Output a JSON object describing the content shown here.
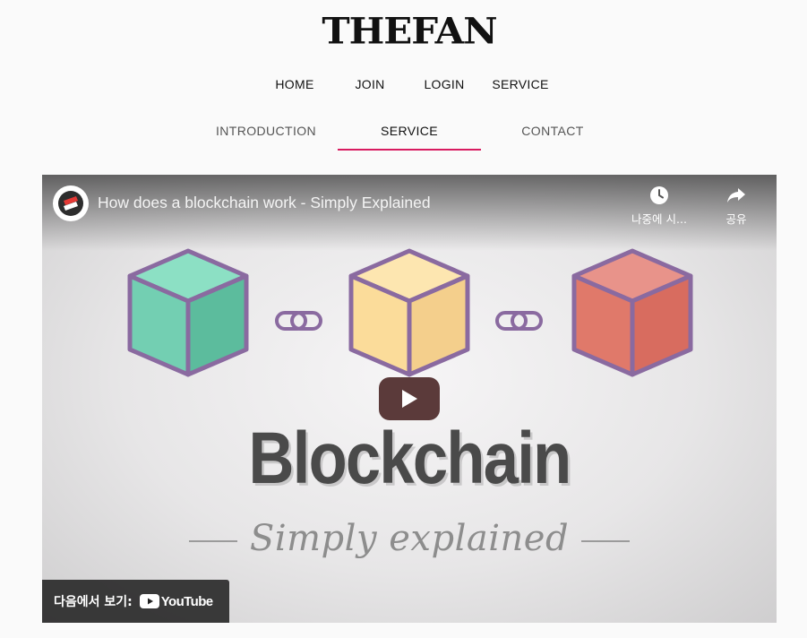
{
  "brand": {
    "logo_text": "THEFAN"
  },
  "nav_top": {
    "items": [
      "HOME",
      "JOIN",
      "LOGIN",
      "SERVICE"
    ]
  },
  "nav_sub": {
    "items": [
      "INTRODUCTION",
      "SERVICE",
      "CONTACT"
    ],
    "active": "SERVICE",
    "accent_color": "#d81b60"
  },
  "video": {
    "title": "How does a blockchain work - Simply Explained",
    "watch_later_label": "나중에 시...",
    "share_label": "공유",
    "thumbnail_title": "Blockchain",
    "thumbnail_subtitle": "Simply explained",
    "watch_on_label": "다음에서 보기:",
    "youtube_wordmark": "YouTube",
    "block_colors": [
      "#73cfb2",
      "#fbdc9a",
      "#e0796a"
    ],
    "outline_color": "#8a6aa0"
  }
}
